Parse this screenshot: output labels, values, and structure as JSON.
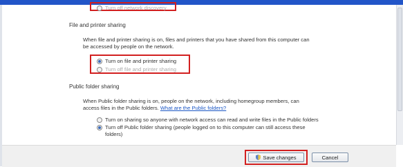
{
  "network_discovery": {
    "off_option": "Turn off network discovery"
  },
  "file_printer_sharing": {
    "title": "File and printer sharing",
    "description_line1": "When file and printer sharing is on, files and printers that you have shared from this computer can",
    "description_line2": "be accessed by people on the network.",
    "on_option": "Turn on file and printer sharing",
    "off_option": "Turn off file and printer sharing",
    "selected": "on"
  },
  "public_folder_sharing": {
    "title": "Public folder sharing",
    "description_line1": "When Public folder sharing is on, people on the network, including homegroup members, can",
    "description_line2": "access files in the Public folders.",
    "link": "What are the Public folders?",
    "on_option": "Turn on sharing so anyone with network access can read and write files in the Public folders",
    "off_option_line1": "Turn off Public folder sharing (people logged on to this computer can still access these",
    "off_option_line2": "folders)",
    "selected": "off"
  },
  "footer": {
    "save_label": "Save changes",
    "cancel_label": "Cancel"
  },
  "icons": {
    "save": "uac-shield-icon"
  },
  "colors": {
    "highlight": "#d21f1f",
    "link": "#1a56c4",
    "title_bar": "#2255c8"
  }
}
